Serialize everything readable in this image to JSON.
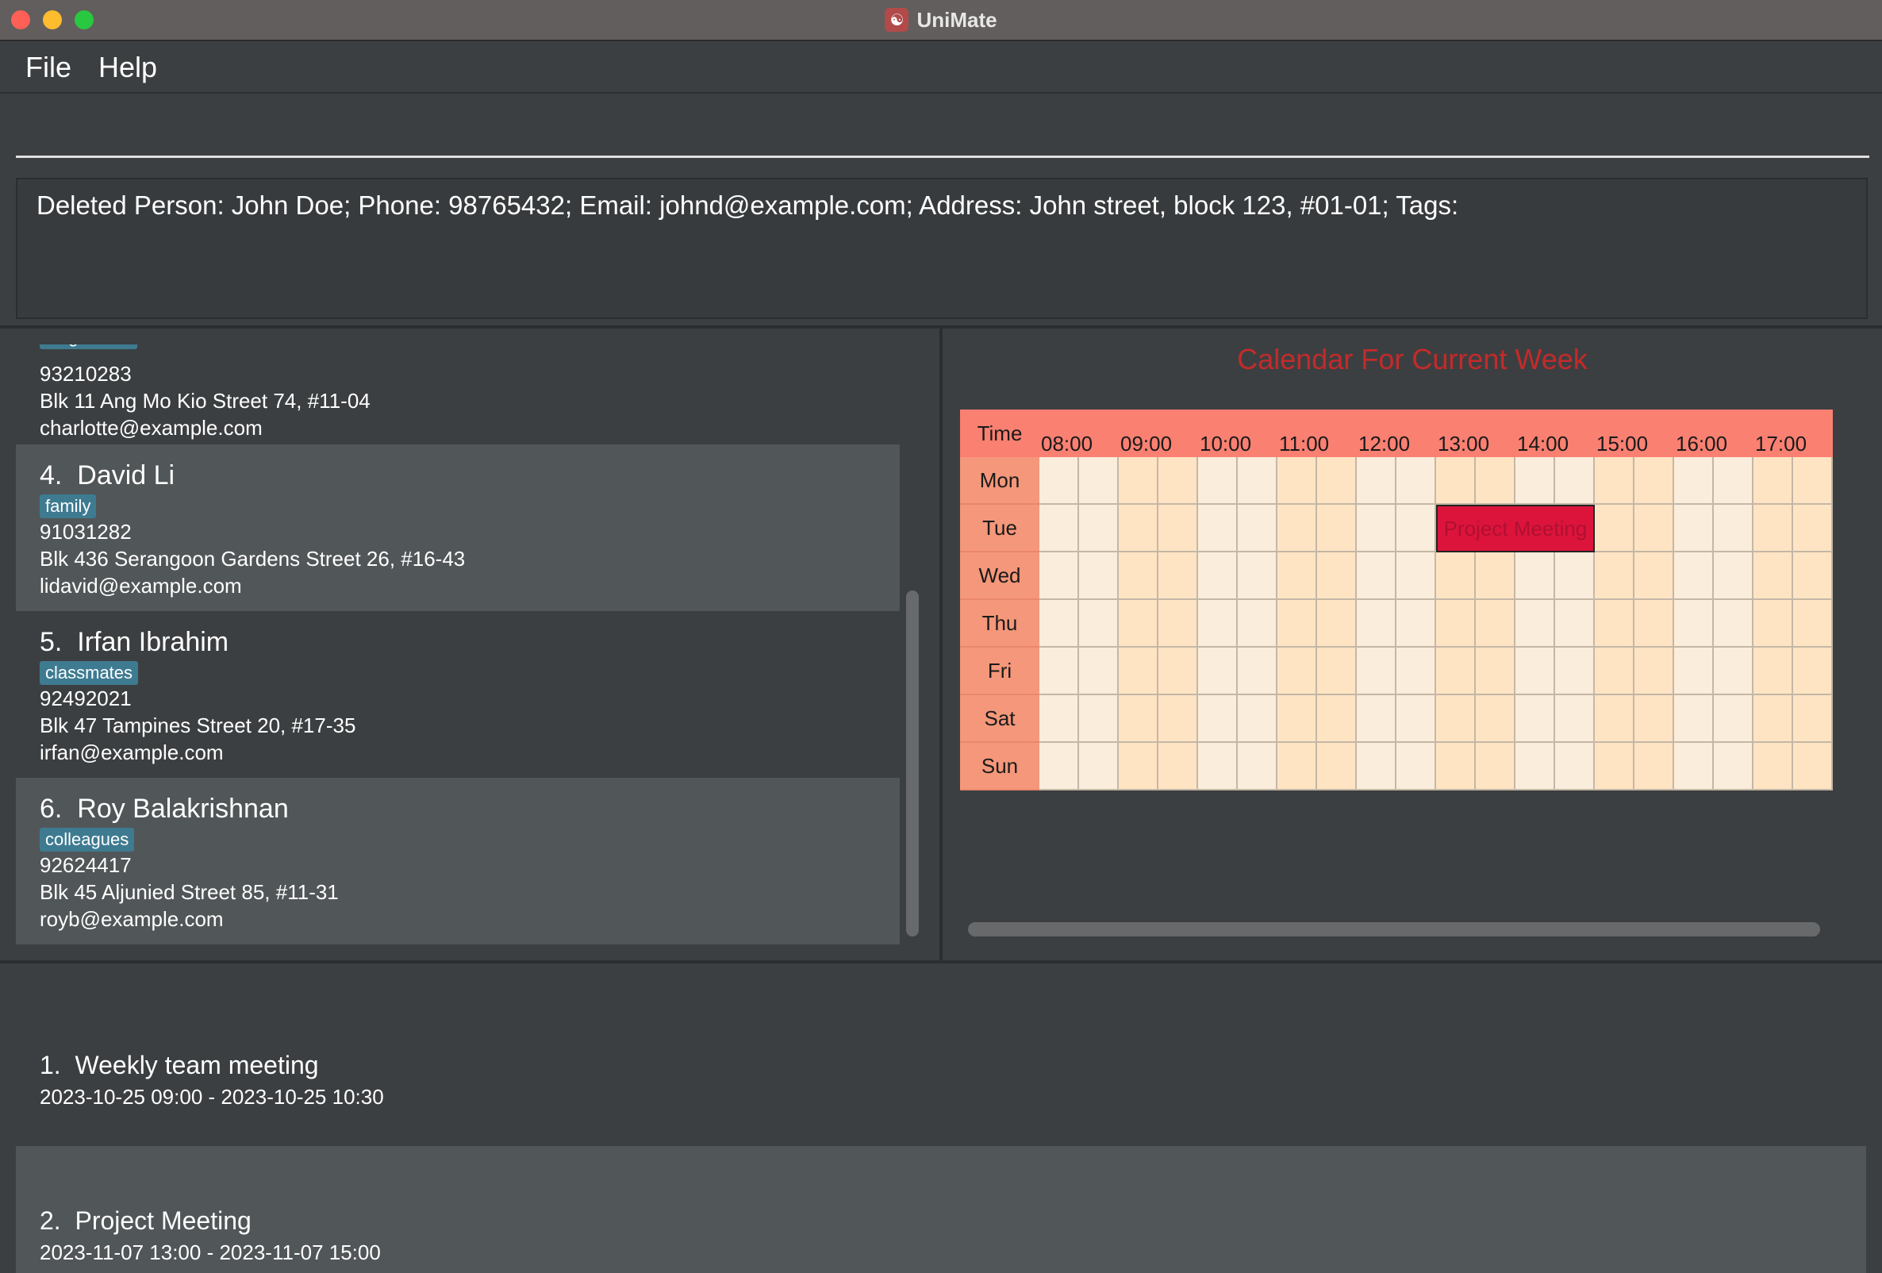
{
  "window": {
    "title": "UniMate",
    "icon": "people-icon"
  },
  "menu": {
    "file": "File",
    "help": "Help"
  },
  "command": {
    "value": "",
    "placeholder": ""
  },
  "result": "Deleted Person: John Doe; Phone: 98765432; Email: johnd@example.com; Address: John street, block 123, #01-01; Tags:",
  "persons": [
    {
      "tag": "neighbours",
      "phone": "93210283",
      "address": "Blk 11 Ang Mo Kio Street 74, #11-04",
      "email": "charlotte@example.com"
    },
    {
      "index": "4.",
      "name": "David Li",
      "tag": "family",
      "phone": "91031282",
      "address": "Blk 436 Serangoon Gardens Street 26, #16-43",
      "email": "lidavid@example.com"
    },
    {
      "index": "5.",
      "name": "Irfan Ibrahim",
      "tag": "classmates",
      "phone": "92492021",
      "address": "Blk 47 Tampines Street 20, #17-35",
      "email": "irfan@example.com"
    },
    {
      "index": "6.",
      "name": "Roy Balakrishnan",
      "tag": "colleagues",
      "phone": "92624417",
      "address": "Blk 45 Aljunied Street 85, #11-31",
      "email": "royb@example.com"
    }
  ],
  "calendar": {
    "title": "Calendar For Current Week",
    "time_header": "Time",
    "hours": [
      "08:00",
      "09:00",
      "10:00",
      "11:00",
      "12:00",
      "13:00",
      "14:00",
      "15:00",
      "16:00",
      "17:00"
    ],
    "days": [
      "Mon",
      "Tue",
      "Wed",
      "Thu",
      "Fri",
      "Sat",
      "Sun"
    ],
    "events": [
      {
        "label": "Project Meeting",
        "day": "Tue",
        "start": "13:00",
        "end": "15:00"
      }
    ],
    "colors": {
      "header": "#fa8072",
      "day": "#f4977a",
      "slot_a": "#fbeddb",
      "slot_b": "#ffe4c4",
      "event": "#dc143c",
      "title": "#c42a2a"
    }
  },
  "events": [
    {
      "index": "1.",
      "name": "Weekly team meeting",
      "time": "2023-10-25 09:00 - 2023-10-25 10:30"
    },
    {
      "index": "2.",
      "name": "Project Meeting",
      "time": "2023-11-07 13:00 - 2023-11-07 15:00"
    }
  ]
}
